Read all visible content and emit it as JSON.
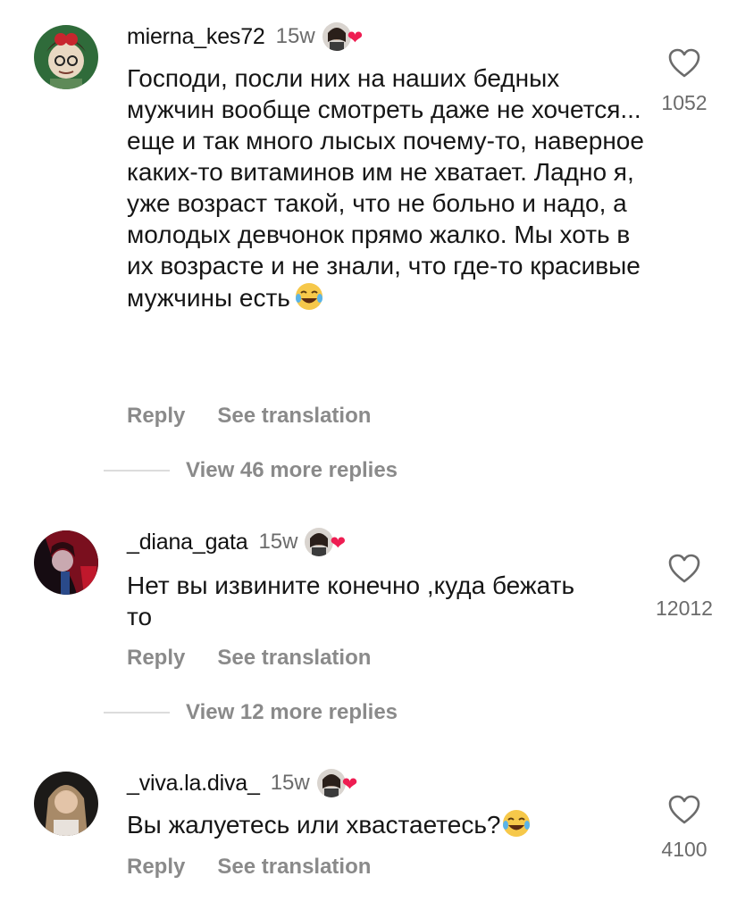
{
  "comments": [
    {
      "username": "mierna_kes72",
      "time": "15w",
      "text": "Господи, посли них на наших бедных мужчин вообще смотреть даже не хочется... еще и так много лысых почему-то,  наверное каких-то витаминов им не хватает. Ладно я, уже возраст такой, что не больно и надо, а молодых девчонок прямо жалко. Мы хоть в их возрасте и не знали, что где-то красивые мужчины есть",
      "emoji": "laughing-crying-emoji",
      "reply_label": "Reply",
      "translate_label": "See translation",
      "view_replies": "View 46 more replies",
      "likes": "1052"
    },
    {
      "username": "_diana_gata",
      "time": "15w",
      "text": "Нет вы извините конечно ,куда бежать то",
      "reply_label": "Reply",
      "translate_label": "See translation",
      "view_replies": "View 12 more replies",
      "likes": "12012"
    },
    {
      "username": "_viva.la.diva_",
      "time": "15w",
      "text": "Вы жалуетесь или хвастаетесь?",
      "emoji": "laughing-crying-emoji",
      "reply_label": "Reply",
      "translate_label": "See translation",
      "likes": "4100"
    }
  ],
  "icons": {
    "like": "heart-outline-icon",
    "creator_liked": "heart-filled-icon"
  },
  "colors": {
    "heart_accent": "#ee1d52",
    "muted_text": "#8a8a8a"
  }
}
